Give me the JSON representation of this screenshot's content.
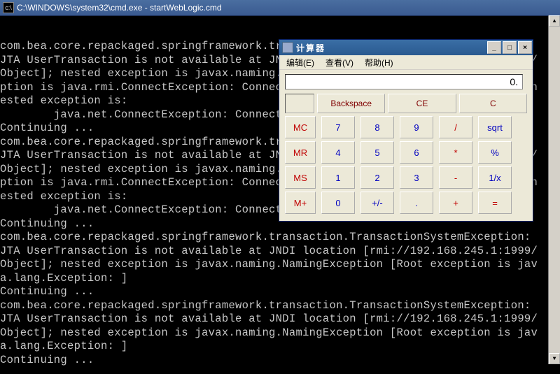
{
  "cmd": {
    "title": "C:\\WINDOWS\\system32\\cmd.exe - startWebLogic.cmd",
    "lines": [
      "",
      "com.bea.core.repackaged.springframework.transaction.TransactionSystemException:",
      "JTA UserTransaction is not available at JNDI location [rmi://192.168.245.1:1999/",
      "Object]; nested exception is javax.naming.NamingException [Root exception is ja",
      "ption is java.rmi.ConnectException: Connection refused to host: 192.168.245.1; n",
      "ested exception is:",
      "        java.net.ConnectException: Connection refused: connect]",
      "Continuing ...",
      "com.bea.core.repackaged.springframework.transaction.TransactionSystemException:",
      "JTA UserTransaction is not available at JNDI location [rmi://192.168.245.1:1999/",
      "Object]; nested exception is javax.naming.NamingException [Root exception is ja",
      "ption is java.rmi.ConnectException: Connection refused to host: 192.168.245.1; n",
      "ested exception is:",
      "        java.net.ConnectException: Connection refused: connect]",
      "Continuing ...",
      "com.bea.core.repackaged.springframework.transaction.TransactionSystemException:",
      "JTA UserTransaction is not available at JNDI location [rmi://192.168.245.1:1999/",
      "Object]; nested exception is javax.naming.NamingException [Root exception is jav",
      "a.lang.Exception: ]",
      "Continuing ...",
      "com.bea.core.repackaged.springframework.transaction.TransactionSystemException:",
      "JTA UserTransaction is not available at JNDI location [rmi://192.168.245.1:1999/",
      "Object]; nested exception is javax.naming.NamingException [Root exception is jav",
      "a.lang.Exception: ]",
      "Continuing ..."
    ]
  },
  "calc": {
    "title": "计算器",
    "menu": {
      "edit": "编辑(E)",
      "view": "查看(V)",
      "help": "帮助(H)"
    },
    "display": "0.",
    "wide": {
      "backspace": "Backspace",
      "ce": "CE",
      "c": "C"
    },
    "mem": {
      "mc": "MC",
      "mr": "MR",
      "ms": "MS",
      "mplus": "M+"
    },
    "keys": {
      "7": "7",
      "8": "8",
      "9": "9",
      "div": "/",
      "sqrt": "sqrt",
      "4": "4",
      "5": "5",
      "6": "6",
      "mul": "*",
      "pct": "%",
      "1": "1",
      "2": "2",
      "3": "3",
      "sub": "-",
      "inv": "1/x",
      "0": "0",
      "pm": "+/-",
      "dot": ".",
      "add": "+",
      "eq": "="
    }
  }
}
